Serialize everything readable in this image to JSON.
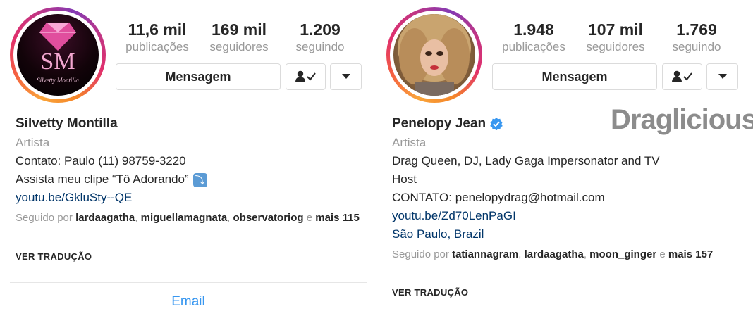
{
  "left": {
    "avatar_logo_text": "SM",
    "avatar_logo_script": "Silvetty Montilla",
    "stats": [
      {
        "num": "11,6 mil",
        "label": "publicações"
      },
      {
        "num": "169 mil",
        "label": "seguidores"
      },
      {
        "num": "1.209",
        "label": "seguindo"
      }
    ],
    "message_button": "Mensagem",
    "name": "Silvetty Montilla",
    "category": "Artista",
    "bio": [
      "Contato: Paulo (11) 98759-3220",
      "Assista meu clipe “Tô Adorando”"
    ],
    "link": "youtu.be/GkluSty--QE",
    "followed_by": {
      "prefix": "Seguido por",
      "users": [
        "lardaagatha",
        "miguellamagnata",
        "observatoriog"
      ],
      "connector": "e",
      "more": "mais 115"
    },
    "translate": "VER TRADUÇÃO",
    "email": "Email"
  },
  "right": {
    "stats": [
      {
        "num": "1.948",
        "label": "publicações"
      },
      {
        "num": "107 mil",
        "label": "seguidores"
      },
      {
        "num": "1.769",
        "label": "seguindo"
      }
    ],
    "message_button": "Mensagem",
    "name": "Penelopy Jean",
    "category": "Artista",
    "bio": [
      "Drag Queen, DJ, Lady Gaga Impersonator and TV",
      "Host",
      "CONTATO: penelopydrag@hotmail.com"
    ],
    "link": "youtu.be/Zd70LenPaGI",
    "location": "São Paulo, Brazil",
    "followed_by": {
      "prefix": "Seguido por",
      "users": [
        "tatiannagram",
        "lardaagatha",
        "moon_ginger"
      ],
      "connector": "e",
      "more": "mais 157"
    },
    "translate": "VER TRADUÇÃO"
  },
  "watermark": "Draglicious",
  "colors": {
    "link": "#003569",
    "email_link": "#3897f0",
    "verified_badge": "#3897f0",
    "muted_text": "#999999"
  },
  "icons": [
    "person-check-icon",
    "chevron-down-icon",
    "verified-badge-icon",
    "arrow-emoji-icon"
  ]
}
